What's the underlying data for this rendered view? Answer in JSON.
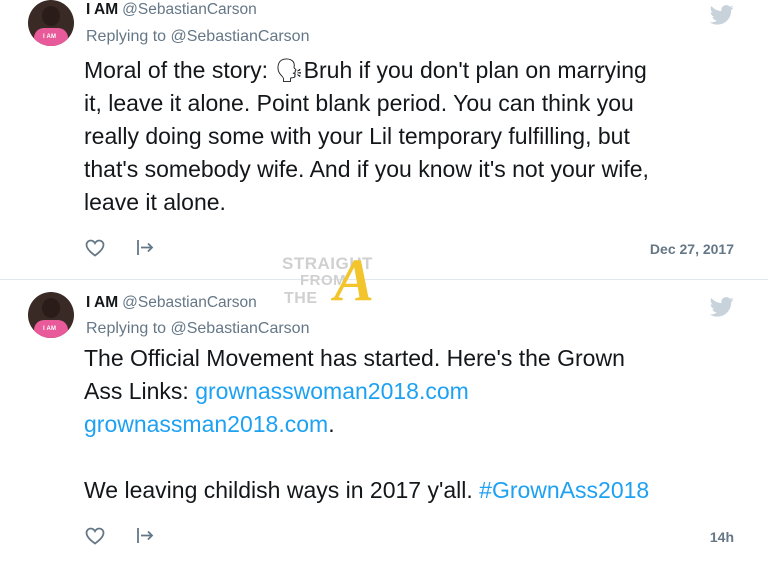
{
  "tweets": [
    {
      "name": "I AM",
      "handle": "@SebastianCarson",
      "avatar_badge": "I AM",
      "replying_to": "Replying to @SebastianCarson",
      "lines": [
        "Moral of the story: 🗣Bruh if you don't plan on marrying",
        "it, leave it alone. Point blank period. You can think you",
        "really doing some with your Lil temporary fulfilling, but",
        "that's somebody wife. And if you know it's not your wife,",
        "leave it alone."
      ],
      "timestamp": "Dec 27, 2017",
      "icons": [
        "heart-icon",
        "share-icon",
        "twitter-bird-icon"
      ]
    },
    {
      "name": "I AM",
      "handle": "@SebastianCarson",
      "avatar_badge": "I AM",
      "replying_to": "Replying to @SebastianCarson",
      "line1": "The Official Movement has started. Here's the Grown",
      "line2_text": "Ass Links: ",
      "line2_link": "grownasswoman2018.com",
      "line3_link": "grownassman2018.com",
      "line3_text": ".",
      "line4_text": "We leaving childish ways in 2017 y'all. ",
      "line4_hashtag": "#GrownAss2018",
      "timestamp": "14h",
      "icons": [
        "heart-icon",
        "share-icon",
        "twitter-bird-icon"
      ]
    }
  ],
  "watermark": {
    "line1": "STRAIGHT",
    "line2": "FROM",
    "line3": "THE",
    "letter": "A"
  },
  "colors": {
    "link": "#1da1f2",
    "secondary_text": "#657786",
    "divider": "#e1e8ed",
    "bird": "#c8d2da",
    "watermark_accent": "#f1c52b"
  }
}
